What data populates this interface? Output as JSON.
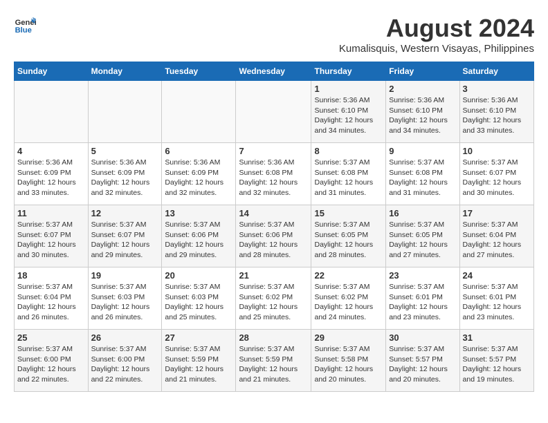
{
  "logo": {
    "line1": "General",
    "line2": "Blue"
  },
  "title": {
    "month_year": "August 2024",
    "location": "Kumalisquis, Western Visayas, Philippines"
  },
  "headers": [
    "Sunday",
    "Monday",
    "Tuesday",
    "Wednesday",
    "Thursday",
    "Friday",
    "Saturday"
  ],
  "weeks": [
    [
      {
        "day": "",
        "content": ""
      },
      {
        "day": "",
        "content": ""
      },
      {
        "day": "",
        "content": ""
      },
      {
        "day": "",
        "content": ""
      },
      {
        "day": "1",
        "content": "Sunrise: 5:36 AM\nSunset: 6:10 PM\nDaylight: 12 hours\nand 34 minutes."
      },
      {
        "day": "2",
        "content": "Sunrise: 5:36 AM\nSunset: 6:10 PM\nDaylight: 12 hours\nand 34 minutes."
      },
      {
        "day": "3",
        "content": "Sunrise: 5:36 AM\nSunset: 6:10 PM\nDaylight: 12 hours\nand 33 minutes."
      }
    ],
    [
      {
        "day": "4",
        "content": "Sunrise: 5:36 AM\nSunset: 6:09 PM\nDaylight: 12 hours\nand 33 minutes."
      },
      {
        "day": "5",
        "content": "Sunrise: 5:36 AM\nSunset: 6:09 PM\nDaylight: 12 hours\nand 32 minutes."
      },
      {
        "day": "6",
        "content": "Sunrise: 5:36 AM\nSunset: 6:09 PM\nDaylight: 12 hours\nand 32 minutes."
      },
      {
        "day": "7",
        "content": "Sunrise: 5:36 AM\nSunset: 6:08 PM\nDaylight: 12 hours\nand 32 minutes."
      },
      {
        "day": "8",
        "content": "Sunrise: 5:37 AM\nSunset: 6:08 PM\nDaylight: 12 hours\nand 31 minutes."
      },
      {
        "day": "9",
        "content": "Sunrise: 5:37 AM\nSunset: 6:08 PM\nDaylight: 12 hours\nand 31 minutes."
      },
      {
        "day": "10",
        "content": "Sunrise: 5:37 AM\nSunset: 6:07 PM\nDaylight: 12 hours\nand 30 minutes."
      }
    ],
    [
      {
        "day": "11",
        "content": "Sunrise: 5:37 AM\nSunset: 6:07 PM\nDaylight: 12 hours\nand 30 minutes."
      },
      {
        "day": "12",
        "content": "Sunrise: 5:37 AM\nSunset: 6:07 PM\nDaylight: 12 hours\nand 29 minutes."
      },
      {
        "day": "13",
        "content": "Sunrise: 5:37 AM\nSunset: 6:06 PM\nDaylight: 12 hours\nand 29 minutes."
      },
      {
        "day": "14",
        "content": "Sunrise: 5:37 AM\nSunset: 6:06 PM\nDaylight: 12 hours\nand 28 minutes."
      },
      {
        "day": "15",
        "content": "Sunrise: 5:37 AM\nSunset: 6:05 PM\nDaylight: 12 hours\nand 28 minutes."
      },
      {
        "day": "16",
        "content": "Sunrise: 5:37 AM\nSunset: 6:05 PM\nDaylight: 12 hours\nand 27 minutes."
      },
      {
        "day": "17",
        "content": "Sunrise: 5:37 AM\nSunset: 6:04 PM\nDaylight: 12 hours\nand 27 minutes."
      }
    ],
    [
      {
        "day": "18",
        "content": "Sunrise: 5:37 AM\nSunset: 6:04 PM\nDaylight: 12 hours\nand 26 minutes."
      },
      {
        "day": "19",
        "content": "Sunrise: 5:37 AM\nSunset: 6:03 PM\nDaylight: 12 hours\nand 26 minutes."
      },
      {
        "day": "20",
        "content": "Sunrise: 5:37 AM\nSunset: 6:03 PM\nDaylight: 12 hours\nand 25 minutes."
      },
      {
        "day": "21",
        "content": "Sunrise: 5:37 AM\nSunset: 6:02 PM\nDaylight: 12 hours\nand 25 minutes."
      },
      {
        "day": "22",
        "content": "Sunrise: 5:37 AM\nSunset: 6:02 PM\nDaylight: 12 hours\nand 24 minutes."
      },
      {
        "day": "23",
        "content": "Sunrise: 5:37 AM\nSunset: 6:01 PM\nDaylight: 12 hours\nand 23 minutes."
      },
      {
        "day": "24",
        "content": "Sunrise: 5:37 AM\nSunset: 6:01 PM\nDaylight: 12 hours\nand 23 minutes."
      }
    ],
    [
      {
        "day": "25",
        "content": "Sunrise: 5:37 AM\nSunset: 6:00 PM\nDaylight: 12 hours\nand 22 minutes."
      },
      {
        "day": "26",
        "content": "Sunrise: 5:37 AM\nSunset: 6:00 PM\nDaylight: 12 hours\nand 22 minutes."
      },
      {
        "day": "27",
        "content": "Sunrise: 5:37 AM\nSunset: 5:59 PM\nDaylight: 12 hours\nand 21 minutes."
      },
      {
        "day": "28",
        "content": "Sunrise: 5:37 AM\nSunset: 5:59 PM\nDaylight: 12 hours\nand 21 minutes."
      },
      {
        "day": "29",
        "content": "Sunrise: 5:37 AM\nSunset: 5:58 PM\nDaylight: 12 hours\nand 20 minutes."
      },
      {
        "day": "30",
        "content": "Sunrise: 5:37 AM\nSunset: 5:57 PM\nDaylight: 12 hours\nand 20 minutes."
      },
      {
        "day": "31",
        "content": "Sunrise: 5:37 AM\nSunset: 5:57 PM\nDaylight: 12 hours\nand 19 minutes."
      }
    ]
  ]
}
